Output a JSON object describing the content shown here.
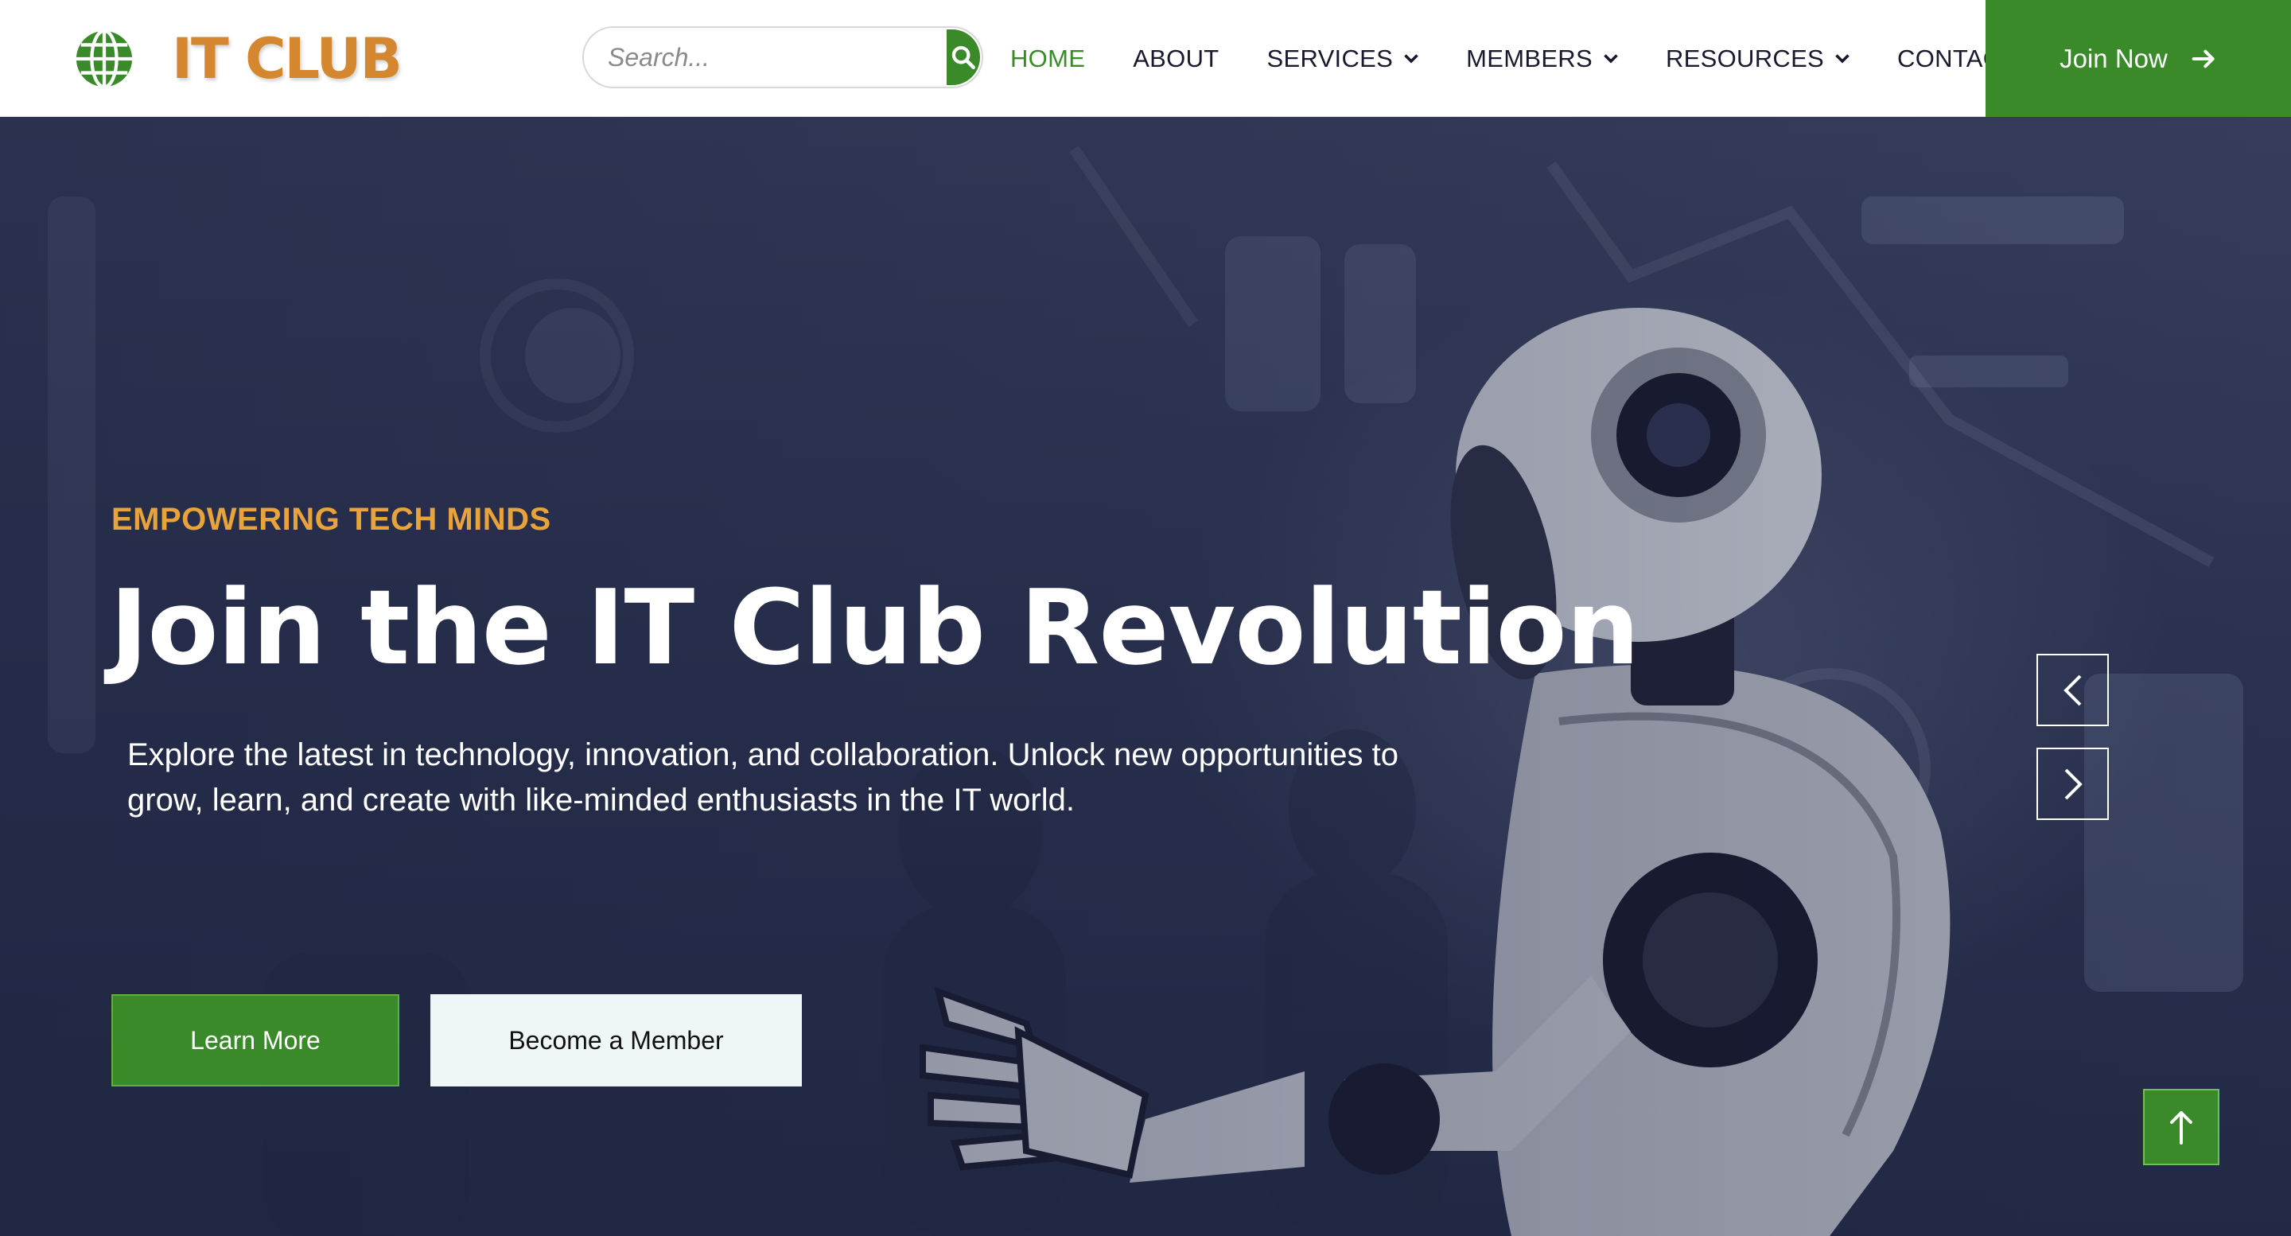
{
  "brand": {
    "name": "IT CLUB",
    "logo_icon": "globe-icon",
    "accent": "#d4872e"
  },
  "search": {
    "placeholder": "Search...",
    "icon": "search-icon"
  },
  "nav": {
    "items": [
      {
        "label": "HOME",
        "active": true
      },
      {
        "label": "ABOUT"
      },
      {
        "label": "SERVICES",
        "dropdown": true
      },
      {
        "label": "MEMBERS",
        "dropdown": true
      },
      {
        "label": "RESOURCES",
        "dropdown": true
      },
      {
        "label": "CONTACT"
      }
    ]
  },
  "header_cta": {
    "label": "Join Now",
    "icon": "arrow-right-icon"
  },
  "hero": {
    "eyebrow": "EMPOWERING TECH MINDS",
    "title": "Join the IT Club Revolution",
    "lead": "Explore the latest in technology, innovation, and collaboration. Unlock new opportunities to grow, learn, and create with like-minded enthusiasts in the IT world.",
    "primary_button": "Learn More",
    "secondary_button": "Become a Member",
    "prev_icon": "chevron-left-icon",
    "next_icon": "chevron-right-icon"
  },
  "back_to_top": {
    "icon": "arrow-up-icon"
  },
  "colors": {
    "primary": "#3b8a2a",
    "eyebrow": "#e8a33a",
    "hero_bg": "#2c3452",
    "text": "#1a1a2e"
  }
}
